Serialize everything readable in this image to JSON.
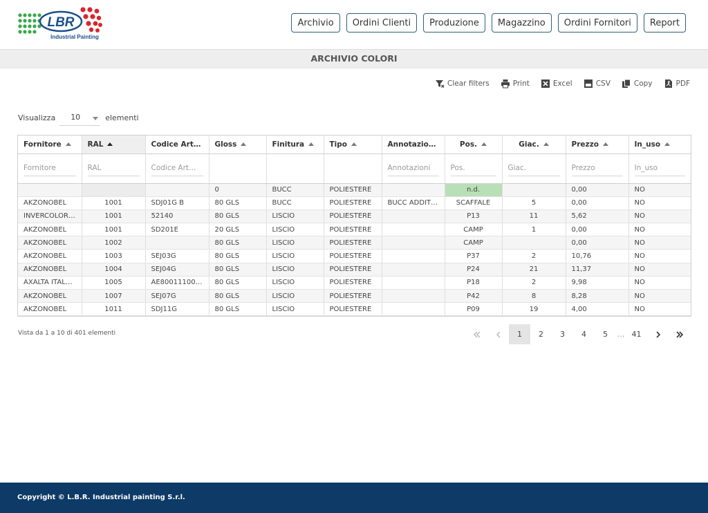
{
  "brand": {
    "logo_text": "LBR",
    "logo_sub": "Industrial Painting"
  },
  "nav": [
    "Archivio",
    "Ordini Clienti",
    "Produzione",
    "Magazzino",
    "Ordini Fornitori",
    "Report"
  ],
  "page_title": "ARCHIVIO COLORI",
  "toolbar": {
    "clear": "Clear filters",
    "print": "Print",
    "excel": "Excel",
    "csv": "CSV",
    "copy": "Copy",
    "pdf": "PDF"
  },
  "length": {
    "prefix": "Visualizza",
    "value": "10",
    "suffix": "elementi"
  },
  "columns": [
    "Fornitore",
    "RAL",
    "Codice Artic…",
    "Gloss",
    "Finitura",
    "Tipo",
    "Annotazioni…",
    "Pos.",
    "Giac.",
    "Prezzo",
    "In_uso"
  ],
  "filters": {
    "fornitore": "Fornitore",
    "ral": "RAL",
    "codice": "Codice Art…",
    "annotazioni": "Annotazioni",
    "pos": "Pos.",
    "giac": "Giac.",
    "prezzo": "Prezzo",
    "in_uso": "In_uso"
  },
  "rows": [
    {
      "fornitore": "",
      "ral": "",
      "codice": "",
      "gloss": "0",
      "finitura": "BUCC",
      "tipo": "POLIESTERE",
      "annotazioni": "",
      "pos": "n.d.",
      "giac": "",
      "prezzo": "0,00",
      "in_uso": "NO"
    },
    {
      "fornitore": "AKZONOBEL",
      "ral": "1001",
      "codice": "SDJ01G B",
      "gloss": "80 GLS",
      "finitura": "BUCC",
      "tipo": "POLIESTERE",
      "annotazioni": "BUCC ADDITI…",
      "pos": "SCAFFALE",
      "giac": "5",
      "prezzo": "0,00",
      "in_uso": "NO"
    },
    {
      "fornitore": "INVERCOLOR…",
      "ral": "1001",
      "codice": "52140",
      "gloss": "80 GLS",
      "finitura": "LISCIO",
      "tipo": "POLIESTERE",
      "annotazioni": "",
      "pos": "P13",
      "giac": "11",
      "prezzo": "5,62",
      "in_uso": "NO"
    },
    {
      "fornitore": "AKZONOBEL",
      "ral": "1001",
      "codice": "SD201E",
      "gloss": "20 GLS",
      "finitura": "LISCIO",
      "tipo": "POLIESTERE",
      "annotazioni": "",
      "pos": "CAMP",
      "giac": "1",
      "prezzo": "0,00",
      "in_uso": "NO"
    },
    {
      "fornitore": "AKZONOBEL",
      "ral": "1002",
      "codice": "",
      "gloss": "80 GLS",
      "finitura": "LISCIO",
      "tipo": "POLIESTERE",
      "annotazioni": "",
      "pos": "CAMP",
      "giac": "",
      "prezzo": "0,00",
      "in_uso": "NO"
    },
    {
      "fornitore": "AKZONOBEL",
      "ral": "1003",
      "codice": "SEJ03G",
      "gloss": "80 GLS",
      "finitura": "LISCIO",
      "tipo": "POLIESTERE",
      "annotazioni": "",
      "pos": "P37",
      "giac": "2",
      "prezzo": "10,76",
      "in_uso": "NO"
    },
    {
      "fornitore": "AKZONOBEL",
      "ral": "1004",
      "codice": "SEJ04G",
      "gloss": "80 GLS",
      "finitura": "LISCIO",
      "tipo": "POLIESTERE",
      "annotazioni": "",
      "pos": "P24",
      "giac": "21",
      "prezzo": "11,37",
      "in_uso": "NO"
    },
    {
      "fornitore": "AXALTA ITAL…",
      "ral": "1005",
      "codice": "AE80011100520",
      "gloss": "80 GLS",
      "finitura": "LISCIO",
      "tipo": "POLIESTERE",
      "annotazioni": "",
      "pos": "P18",
      "giac": "2",
      "prezzo": "9,98",
      "in_uso": "NO"
    },
    {
      "fornitore": "AKZONOBEL",
      "ral": "1007",
      "codice": "SEJ07G",
      "gloss": "80 GLS",
      "finitura": "LISCIO",
      "tipo": "POLIESTERE",
      "annotazioni": "",
      "pos": "P42",
      "giac": "8",
      "prezzo": "8,28",
      "in_uso": "NO"
    },
    {
      "fornitore": "AKZONOBEL",
      "ral": "1011",
      "codice": "SDJ11G",
      "gloss": "80 GLS",
      "finitura": "LISCIO",
      "tipo": "POLIESTERE",
      "annotazioni": "",
      "pos": "P09",
      "giac": "19",
      "prezzo": "4,00",
      "in_uso": "NO"
    }
  ],
  "info": "Vista da 1 a 10 di 401 elementi",
  "pagination": {
    "pages": [
      "1",
      "2",
      "3",
      "4",
      "5"
    ],
    "ellipsis": "…",
    "last": "41",
    "current": "1"
  },
  "footer": "Copyright © L.B.R. Industrial painting S.r.l.",
  "colors": {
    "accent": "#2f5f7a",
    "footer": "#0d3a66",
    "highlight_nd": "#b9dfb6"
  }
}
